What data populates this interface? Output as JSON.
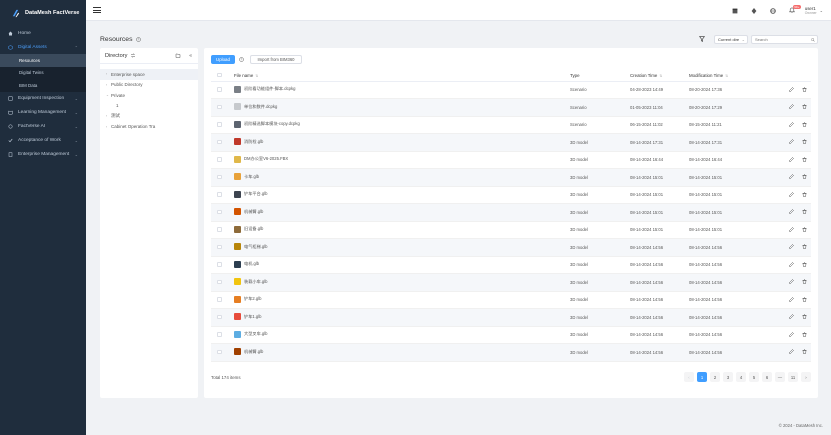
{
  "app": {
    "brand": "DataMesh FactVerse"
  },
  "sidebar": {
    "items": [
      {
        "label": "Home",
        "icon": "home-icon"
      },
      {
        "label": "Digital Assets",
        "icon": "cube-icon",
        "open": true,
        "children": [
          {
            "label": "Resources",
            "active": true
          },
          {
            "label": "Digital Twins",
            "active": false
          },
          {
            "label": "BIM Data",
            "active": false
          }
        ]
      },
      {
        "label": "Equipment Inspection",
        "icon": "inspection-icon"
      },
      {
        "label": "Learning Management",
        "icon": "book-icon"
      },
      {
        "label": "FactVerse AI",
        "icon": "ai-icon"
      },
      {
        "label": "Acceptance of Work",
        "icon": "check-icon"
      },
      {
        "label": "Enterprise Management",
        "icon": "building-icon"
      }
    ]
  },
  "header": {
    "badge": "99+",
    "user_name": "user1",
    "user_sub": "Ownner"
  },
  "page": {
    "title": "Resources",
    "scope": "Current dire",
    "search_placeholder": "Search"
  },
  "directory": {
    "title": "Directory",
    "nodes": [
      {
        "label": "Enterprise space",
        "arrow": "›",
        "selected": true
      },
      {
        "label": "Public Directory",
        "arrow": "›"
      },
      {
        "label": "Private",
        "arrow": "⌄"
      },
      {
        "label": "1",
        "arrow": ""
      },
      {
        "label": "测试",
        "arrow": "›"
      },
      {
        "label": "Cabinet Operation Tra",
        "arrow": "›"
      }
    ]
  },
  "toolbar": {
    "upload": "Upload",
    "import": "Import from BIM360"
  },
  "table": {
    "headers": {
      "name": "File name",
      "type": "Type",
      "created": "Creation Time",
      "modified": "Modification Time"
    },
    "rows": [
      {
        "name": "初阶看功能组件-脚本.dcpkg",
        "type": "Scenario",
        "created": "04-28-2023 14:49",
        "modified": "08-20-2024 17:36",
        "thumb": "#7a7f86"
      },
      {
        "name": "单位和数件.dcpkg",
        "type": "Scenario",
        "created": "01-05-2023 11:04",
        "modified": "08-20-2024 17:29",
        "thumb": "#c6c9cd"
      },
      {
        "name": "初阶精选脚本模块-copy.dcpkg",
        "type": "Scenario",
        "created": "06-15-2024 11:02",
        "modified": "08-15-2024 11:21",
        "thumb": "#5d6470"
      },
      {
        "name": "消防栓.glb",
        "type": "3D model",
        "created": "08-14-2024 17:31",
        "modified": "08-14-2024 17:31",
        "thumb": "#c0392b"
      },
      {
        "name": "DM办公室V6-2025.FBX",
        "type": "3D model",
        "created": "08-14-2024 16:44",
        "modified": "08-14-2024 16:44",
        "thumb": "#e0b84a"
      },
      {
        "name": "卡车.glb",
        "type": "3D model",
        "created": "08-14-2024 15:01",
        "modified": "08-14-2024 15:01",
        "thumb": "#e8a23a"
      },
      {
        "name": "铲车平台.glb",
        "type": "3D model",
        "created": "08-14-2024 15:01",
        "modified": "08-14-2024 15:01",
        "thumb": "#3d4450"
      },
      {
        "name": "机械臂.glb",
        "type": "3D model",
        "created": "08-14-2024 15:01",
        "modified": "08-14-2024 15:01",
        "thumb": "#d35400"
      },
      {
        "name": "旧设备.glb",
        "type": "3D model",
        "created": "08-14-2024 15:01",
        "modified": "08-14-2024 15:01",
        "thumb": "#8e6b3a"
      },
      {
        "name": "电气柜梯.glb",
        "type": "3D model",
        "created": "08-14-2024 14:56",
        "modified": "08-14-2024 14:56",
        "thumb": "#b8860b"
      },
      {
        "name": "电机.glb",
        "type": "3D model",
        "created": "08-14-2024 14:56",
        "modified": "08-14-2024 14:56",
        "thumb": "#2c3e50"
      },
      {
        "name": "装载小车.glb",
        "type": "3D model",
        "created": "08-14-2024 14:56",
        "modified": "08-14-2024 14:56",
        "thumb": "#f1c40f"
      },
      {
        "name": "铲车2.glb",
        "type": "3D model",
        "created": "08-14-2024 14:56",
        "modified": "08-14-2024 14:56",
        "thumb": "#e67e22"
      },
      {
        "name": "铲车1.glb",
        "type": "3D model",
        "created": "08-14-2024 14:56",
        "modified": "08-14-2024 14:56",
        "thumb": "#e74c3c"
      },
      {
        "name": "大型叉车.glb",
        "type": "3D model",
        "created": "08-14-2024 14:56",
        "modified": "08-14-2024 14:56",
        "thumb": "#5dade2"
      },
      {
        "name": "机械臂.glb",
        "type": "3D model",
        "created": "08-14-2024 14:56",
        "modified": "08-14-2024 14:56",
        "thumb": "#a04000"
      }
    ]
  },
  "pagination": {
    "total": "Total 174 items",
    "prev": "‹",
    "next": "›",
    "pages": [
      "1",
      "2",
      "3",
      "4",
      "5",
      "6",
      "—",
      "11"
    ],
    "current": "1"
  },
  "footer": "© 2024 - DataMesh Inc.",
  "colors": {
    "accent": "#409eff",
    "sidebar": "#1f2d3d"
  }
}
